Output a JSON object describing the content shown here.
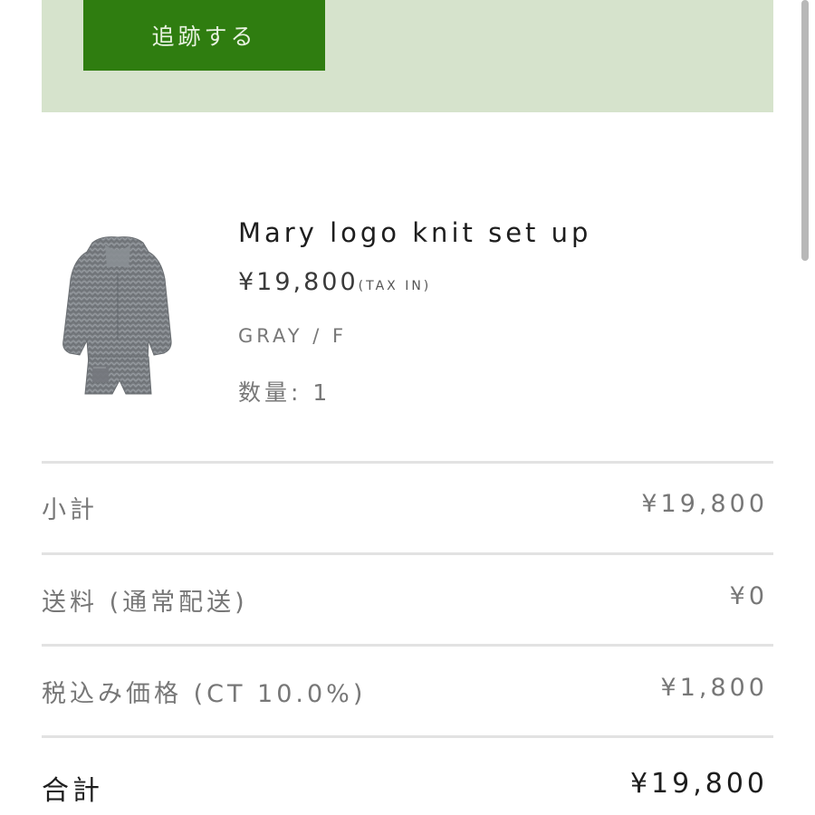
{
  "tracking": {
    "button_label": "追跡する"
  },
  "product": {
    "name": "Mary logo knit set up",
    "price": "¥19,800",
    "tax_note": "(TAX IN)",
    "variant": "GRAY / F",
    "quantity": "数量: 1",
    "image": "gray-knit-set-image"
  },
  "summary": {
    "rows": [
      {
        "label": "小計",
        "value": "¥19,800"
      },
      {
        "label": "送料 (通常配送)",
        "value": "¥0"
      },
      {
        "label": "税込み価格 (CT 10.0%)",
        "value": "¥1,800"
      }
    ],
    "total": {
      "label": "合計",
      "value": "¥19,800"
    }
  },
  "colors": {
    "banner": "#d6e3cc",
    "button": "#2f7d10",
    "divider": "#e2e2e2"
  }
}
